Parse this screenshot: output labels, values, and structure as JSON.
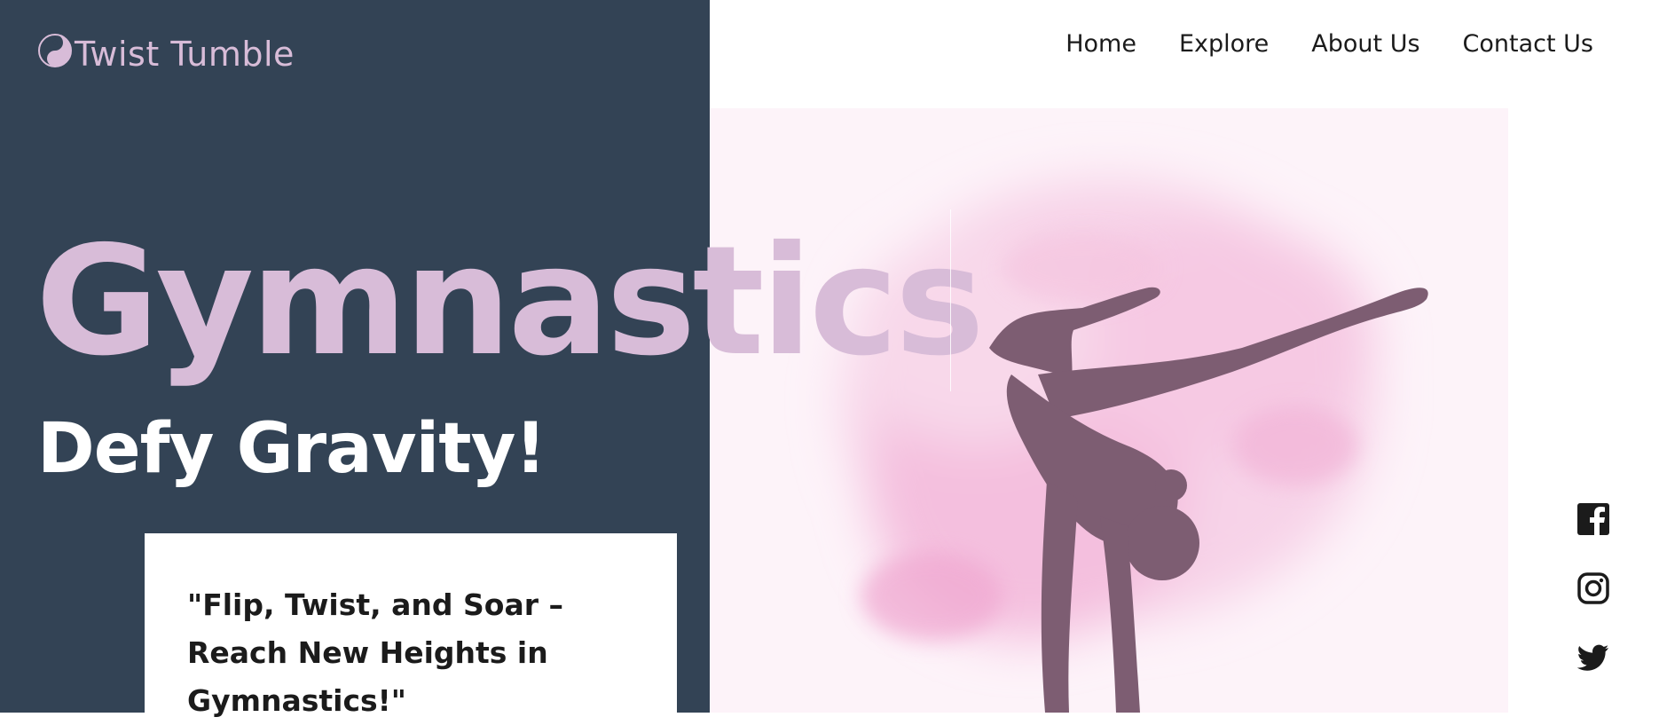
{
  "brand": {
    "name": "Twist Tumble",
    "icon": "yin-yang-icon"
  },
  "nav": {
    "items": [
      {
        "label": "Home"
      },
      {
        "label": "Explore"
      },
      {
        "label": "About Us"
      },
      {
        "label": "Contact Us"
      }
    ]
  },
  "hero": {
    "headline": "Gymnastics",
    "subheadline": "Defy Gravity!",
    "quote": "\"Flip, Twist, and Soar – Reach New Heights in Gymnastics!\""
  },
  "social": {
    "icons": [
      "facebook-icon",
      "instagram-icon",
      "twitter-icon"
    ]
  },
  "colors": {
    "panel": "#334355",
    "accent": "#d8bcd8",
    "silhouette": "#7d5d72",
    "watercolor": "#f3b8da",
    "hero_bg": "#fdf3f9"
  }
}
